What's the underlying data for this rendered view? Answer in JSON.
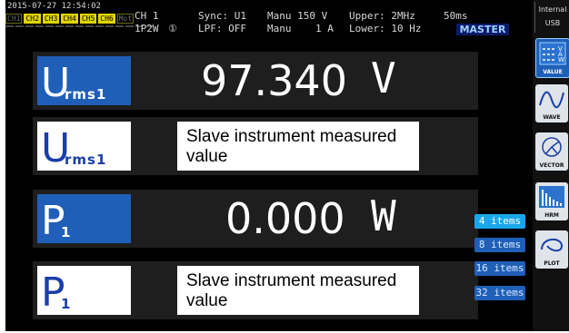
{
  "status": {
    "datetime": "2015-07-27 12:54:02",
    "channels": [
      {
        "label": "CH1",
        "active": false
      },
      {
        "label": "CH2",
        "active": true
      },
      {
        "label": "CH3",
        "active": true
      },
      {
        "label": "CH4",
        "active": true
      },
      {
        "label": "CH5",
        "active": true
      },
      {
        "label": "CH6",
        "active": true
      },
      {
        "label": "Mot",
        "active": false
      }
    ],
    "ch": "CH 1",
    "wiring": "1P2W",
    "wiring_symbol": "①",
    "sync": "Sync: U1",
    "lpf": "LPF: OFF",
    "range_v": "Manu 150 V",
    "range_a": "Manu    1 A",
    "upper": "Upper:  2MHz",
    "lower": "Lower: 10 Hz",
    "rate": "50ms",
    "master": "MASTER",
    "storage_top": "Internal",
    "storage_bottom": "USB"
  },
  "rows": [
    {
      "param": "U",
      "sub": "rms1",
      "tag_style": "blue",
      "value": "97.340",
      "unit": "V"
    },
    {
      "param": "U",
      "sub": "rms1",
      "tag_style": "white",
      "note": "Slave instrument measured value"
    },
    {
      "param": "P",
      "sub": "1",
      "tag_style": "blue",
      "value": "0.000",
      "unit": "W"
    },
    {
      "param": "P",
      "sub": "1",
      "tag_style": "white",
      "note": "Slave instrument measured value"
    }
  ],
  "items": [
    "4 items",
    "8 items",
    "16 items",
    "32 items"
  ],
  "active_item": "4 items",
  "side_buttons": [
    {
      "label": "VALUE",
      "icon": "value-icon",
      "active": true
    },
    {
      "label": "WAVE",
      "icon": "wave-icon",
      "active": false
    },
    {
      "label": "VECTOR",
      "icon": "vector-icon",
      "active": false
    },
    {
      "label": "HRM",
      "icon": "hrm-icon",
      "active": false
    },
    {
      "label": "PLOT",
      "icon": "plot-icon",
      "active": false
    }
  ],
  "colors": {
    "accent_blue": "#1f5fb8",
    "active_item": "#1aa7ea",
    "channel_on": "#e0d400",
    "master_bg": "#0b1a6a"
  }
}
